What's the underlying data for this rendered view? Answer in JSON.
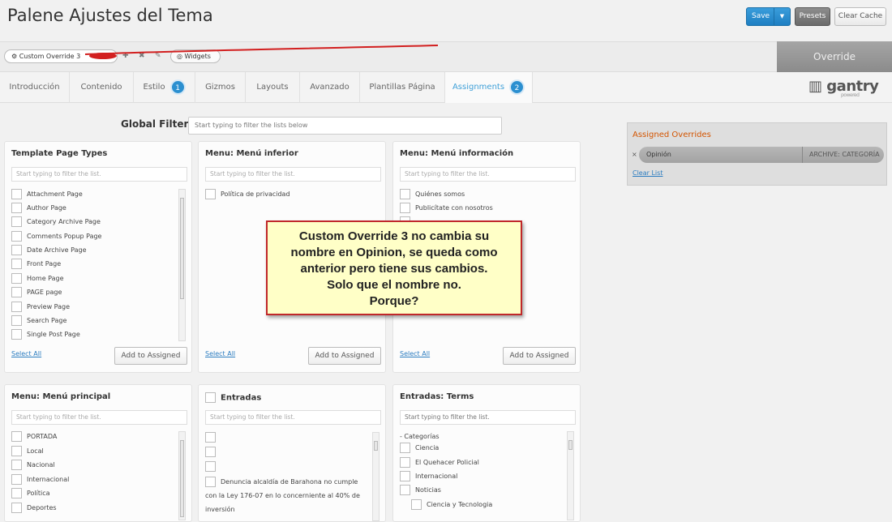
{
  "header": {
    "title": "Palene Ajustes del Tema",
    "save_label": "Save",
    "presets_label": "Presets",
    "clear_cache_label": "Clear Cache"
  },
  "override_bar": {
    "current_override": "Custom Override 3",
    "widgets_label": "Widgets",
    "override_tab_label": "Override"
  },
  "tabs": [
    {
      "label": "Introducción"
    },
    {
      "label": "Contenido"
    },
    {
      "label": "Estilo",
      "badge": "1"
    },
    {
      "label": "Gizmos"
    },
    {
      "label": "Layouts"
    },
    {
      "label": "Avanzado"
    },
    {
      "label": "Plantillas Página"
    },
    {
      "label": "Assignments",
      "badge": "2"
    }
  ],
  "logo": {
    "name": "gantry",
    "sub": "powered"
  },
  "global_filter": {
    "label": "Global Filter",
    "placeholder": "Start typing to filter the lists below"
  },
  "panels": {
    "template_page_types": {
      "title": "Template Page Types",
      "filter_placeholder": "Start typing to filter the list.",
      "items": [
        "Attachment Page",
        "Author Page",
        "Category Archive Page",
        "Comments Popup Page",
        "Date Archive Page",
        "Front Page",
        "Home Page",
        "PAGE page",
        "Preview Page",
        "Search Page",
        "Single Post Page"
      ],
      "select_all": "Select All",
      "add_label": "Add to Assigned"
    },
    "menu_inferior": {
      "title": "Menu: Menú inferior",
      "filter_placeholder": "Start typing to filter the list.",
      "items": [
        "Política de privacidad"
      ],
      "select_all": "Select All",
      "add_label": "Add to Assigned"
    },
    "menu_informacion": {
      "title": "Menu: Menú información",
      "filter_placeholder": "Start typing to filter the list.",
      "items": [
        "Quiénes somos",
        "Publicítate con nosotros"
      ],
      "select_all": "Select All",
      "add_label": "Add to Assigned"
    },
    "menu_principal": {
      "title": "Menu: Menú principal",
      "filter_placeholder": "Start typing to filter the list.",
      "items": [
        "PORTADA",
        "Local",
        "Nacional",
        "Internacional",
        "Política",
        "Deportes"
      ]
    },
    "entradas": {
      "title": "Entradas",
      "filter_placeholder": "Start typing to filter the list.",
      "item_text": "Denuncia alcaldía de Barahona no cumple con la Ley 176-07 en lo concerniente al 40% de inversión"
    },
    "entradas_terms": {
      "title": "Entradas: Terms",
      "filter_placeholder": "Start typing to filter the list.",
      "group": "- Categorías",
      "items": [
        "Ciencia",
        "El Quehacer Policial",
        "Internacional",
        "Noticias"
      ],
      "sub_item": "Ciencia y Tecnologia"
    }
  },
  "assigned": {
    "title": "Assigned Overrides",
    "row_label": "Opinión",
    "row_type": "ARCHIVE: CATEGORÍA",
    "remove_icon": "×",
    "clear_label": "Clear List"
  },
  "annotation": {
    "text": "Custom Override 3 no cambia su\nnombre en Opinion, se queda como\nanterior pero tiene sus cambios.\nSolo que el nombre no.\nPorque?"
  },
  "colors": {
    "accent_blue": "#2b8fd0",
    "assigned_title": "#d35400",
    "annotation_border": "#c0282a",
    "annotation_bg": "#ffffc7"
  }
}
